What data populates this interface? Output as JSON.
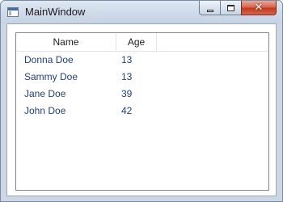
{
  "window": {
    "title": "MainWindow",
    "close_glyph": "✕"
  },
  "listview": {
    "columns": [
      "Name",
      "Age"
    ],
    "rows": [
      {
        "name": "Donna Doe",
        "age": "13"
      },
      {
        "name": "Sammy Doe",
        "age": "13"
      },
      {
        "name": "Jane Doe",
        "age": "39"
      },
      {
        "name": "John Doe",
        "age": "42"
      }
    ]
  },
  "colors": {
    "row_text": "#1f3f7a",
    "close_button": "#c4391f"
  },
  "icons": [
    "app-window-icon",
    "minimize-icon",
    "maximize-icon",
    "close-icon"
  ]
}
